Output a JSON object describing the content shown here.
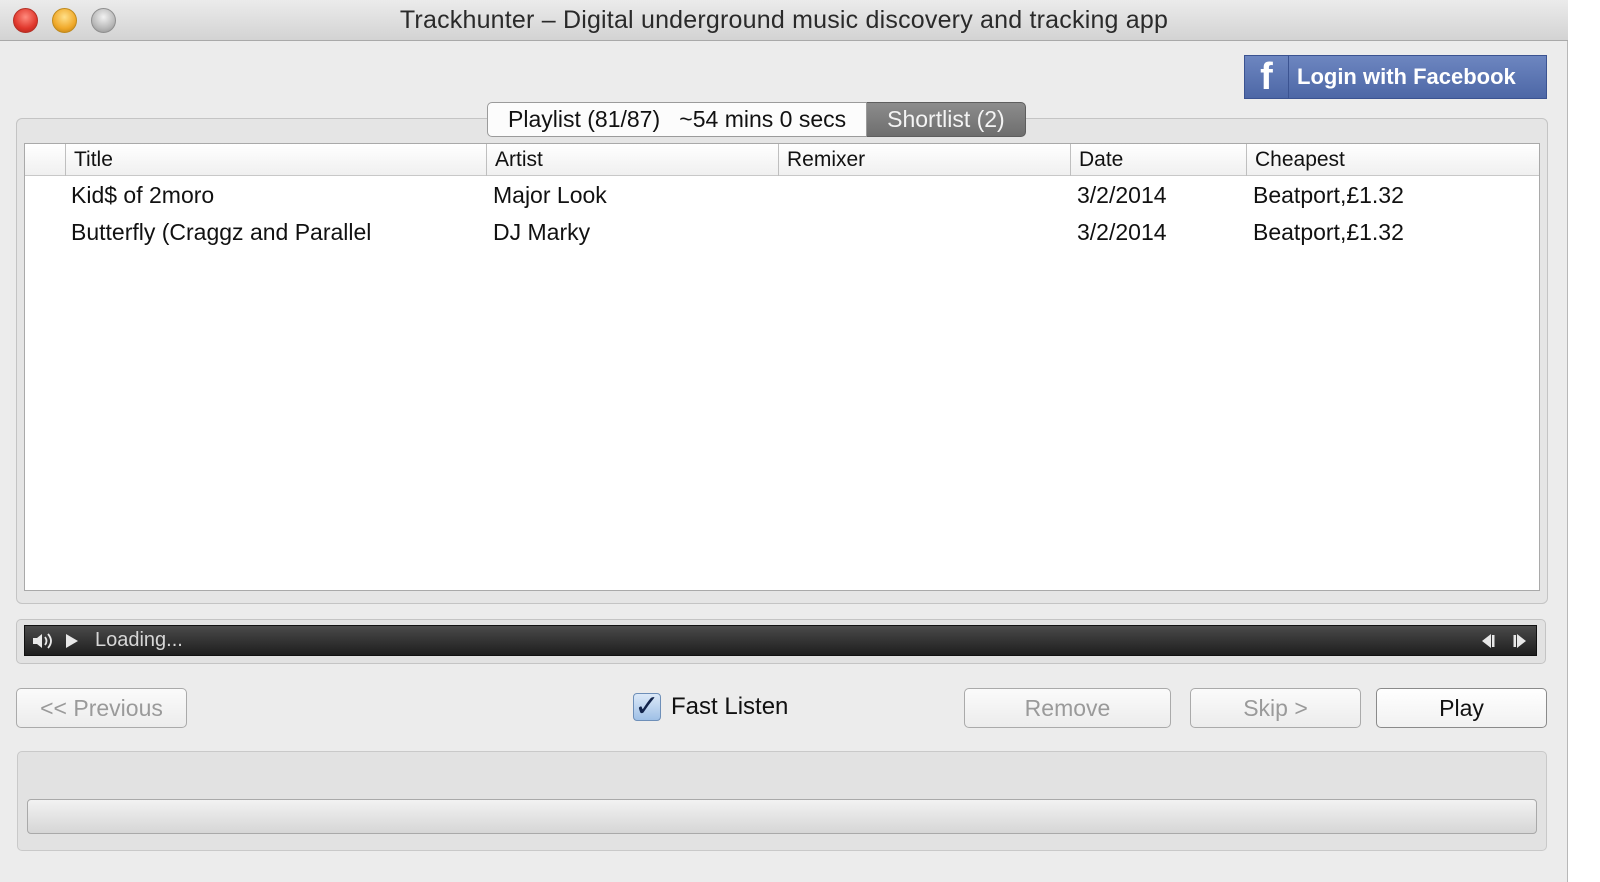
{
  "window": {
    "title": "Trackhunter – Digital underground music discovery and tracking app"
  },
  "facebook": {
    "logo_glyph": "f",
    "label": "Login with Facebook",
    "color": "#5b72b0"
  },
  "tabs": [
    {
      "label": "Playlist (81/87)   ~54 mins 0 secs",
      "selected": false
    },
    {
      "label": "Shortlist (2)",
      "selected": true
    }
  ],
  "table": {
    "columns": [
      "Title",
      "Artist",
      "Remixer",
      "Date",
      "Cheapest"
    ],
    "rows": [
      {
        "title": "Kid$ of 2moro",
        "artist": "Major Look",
        "remixer": "",
        "date": "3/2/2014",
        "cheapest": "Beatport,£1.32"
      },
      {
        "title": "Butterfly (Craggz and Parallel",
        "artist": "DJ Marky",
        "remixer": "",
        "date": "3/2/2014",
        "cheapest": "Beatport,£1.32"
      }
    ]
  },
  "player": {
    "status": "Loading...",
    "icons": [
      "volume-icon",
      "play-icon",
      "rewind-icon",
      "fast-forward-icon"
    ]
  },
  "controls": {
    "previous": "<< Previous",
    "fast_listen": "Fast Listen",
    "fast_listen_checked": true,
    "remove": "Remove",
    "skip": "Skip >",
    "play": "Play"
  }
}
